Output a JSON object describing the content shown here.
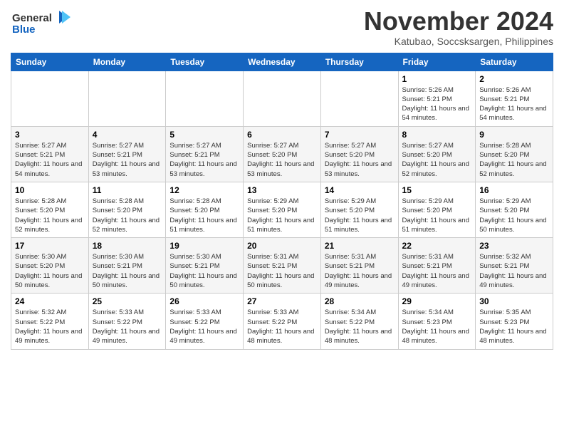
{
  "header": {
    "logo_line1": "General",
    "logo_line2": "Blue",
    "month_title": "November 2024",
    "subtitle": "Katubao, Soccsksargen, Philippines"
  },
  "weekdays": [
    "Sunday",
    "Monday",
    "Tuesday",
    "Wednesday",
    "Thursday",
    "Friday",
    "Saturday"
  ],
  "weeks": [
    [
      {
        "day": "",
        "info": ""
      },
      {
        "day": "",
        "info": ""
      },
      {
        "day": "",
        "info": ""
      },
      {
        "day": "",
        "info": ""
      },
      {
        "day": "",
        "info": ""
      },
      {
        "day": "1",
        "info": "Sunrise: 5:26 AM\nSunset: 5:21 PM\nDaylight: 11 hours and 54 minutes."
      },
      {
        "day": "2",
        "info": "Sunrise: 5:26 AM\nSunset: 5:21 PM\nDaylight: 11 hours and 54 minutes."
      }
    ],
    [
      {
        "day": "3",
        "info": "Sunrise: 5:27 AM\nSunset: 5:21 PM\nDaylight: 11 hours and 54 minutes."
      },
      {
        "day": "4",
        "info": "Sunrise: 5:27 AM\nSunset: 5:21 PM\nDaylight: 11 hours and 53 minutes."
      },
      {
        "day": "5",
        "info": "Sunrise: 5:27 AM\nSunset: 5:21 PM\nDaylight: 11 hours and 53 minutes."
      },
      {
        "day": "6",
        "info": "Sunrise: 5:27 AM\nSunset: 5:20 PM\nDaylight: 11 hours and 53 minutes."
      },
      {
        "day": "7",
        "info": "Sunrise: 5:27 AM\nSunset: 5:20 PM\nDaylight: 11 hours and 53 minutes."
      },
      {
        "day": "8",
        "info": "Sunrise: 5:27 AM\nSunset: 5:20 PM\nDaylight: 11 hours and 52 minutes."
      },
      {
        "day": "9",
        "info": "Sunrise: 5:28 AM\nSunset: 5:20 PM\nDaylight: 11 hours and 52 minutes."
      }
    ],
    [
      {
        "day": "10",
        "info": "Sunrise: 5:28 AM\nSunset: 5:20 PM\nDaylight: 11 hours and 52 minutes."
      },
      {
        "day": "11",
        "info": "Sunrise: 5:28 AM\nSunset: 5:20 PM\nDaylight: 11 hours and 52 minutes."
      },
      {
        "day": "12",
        "info": "Sunrise: 5:28 AM\nSunset: 5:20 PM\nDaylight: 11 hours and 51 minutes."
      },
      {
        "day": "13",
        "info": "Sunrise: 5:29 AM\nSunset: 5:20 PM\nDaylight: 11 hours and 51 minutes."
      },
      {
        "day": "14",
        "info": "Sunrise: 5:29 AM\nSunset: 5:20 PM\nDaylight: 11 hours and 51 minutes."
      },
      {
        "day": "15",
        "info": "Sunrise: 5:29 AM\nSunset: 5:20 PM\nDaylight: 11 hours and 51 minutes."
      },
      {
        "day": "16",
        "info": "Sunrise: 5:29 AM\nSunset: 5:20 PM\nDaylight: 11 hours and 50 minutes."
      }
    ],
    [
      {
        "day": "17",
        "info": "Sunrise: 5:30 AM\nSunset: 5:20 PM\nDaylight: 11 hours and 50 minutes."
      },
      {
        "day": "18",
        "info": "Sunrise: 5:30 AM\nSunset: 5:21 PM\nDaylight: 11 hours and 50 minutes."
      },
      {
        "day": "19",
        "info": "Sunrise: 5:30 AM\nSunset: 5:21 PM\nDaylight: 11 hours and 50 minutes."
      },
      {
        "day": "20",
        "info": "Sunrise: 5:31 AM\nSunset: 5:21 PM\nDaylight: 11 hours and 50 minutes."
      },
      {
        "day": "21",
        "info": "Sunrise: 5:31 AM\nSunset: 5:21 PM\nDaylight: 11 hours and 49 minutes."
      },
      {
        "day": "22",
        "info": "Sunrise: 5:31 AM\nSunset: 5:21 PM\nDaylight: 11 hours and 49 minutes."
      },
      {
        "day": "23",
        "info": "Sunrise: 5:32 AM\nSunset: 5:21 PM\nDaylight: 11 hours and 49 minutes."
      }
    ],
    [
      {
        "day": "24",
        "info": "Sunrise: 5:32 AM\nSunset: 5:22 PM\nDaylight: 11 hours and 49 minutes."
      },
      {
        "day": "25",
        "info": "Sunrise: 5:33 AM\nSunset: 5:22 PM\nDaylight: 11 hours and 49 minutes."
      },
      {
        "day": "26",
        "info": "Sunrise: 5:33 AM\nSunset: 5:22 PM\nDaylight: 11 hours and 49 minutes."
      },
      {
        "day": "27",
        "info": "Sunrise: 5:33 AM\nSunset: 5:22 PM\nDaylight: 11 hours and 48 minutes."
      },
      {
        "day": "28",
        "info": "Sunrise: 5:34 AM\nSunset: 5:22 PM\nDaylight: 11 hours and 48 minutes."
      },
      {
        "day": "29",
        "info": "Sunrise: 5:34 AM\nSunset: 5:23 PM\nDaylight: 11 hours and 48 minutes."
      },
      {
        "day": "30",
        "info": "Sunrise: 5:35 AM\nSunset: 5:23 PM\nDaylight: 11 hours and 48 minutes."
      }
    ]
  ]
}
